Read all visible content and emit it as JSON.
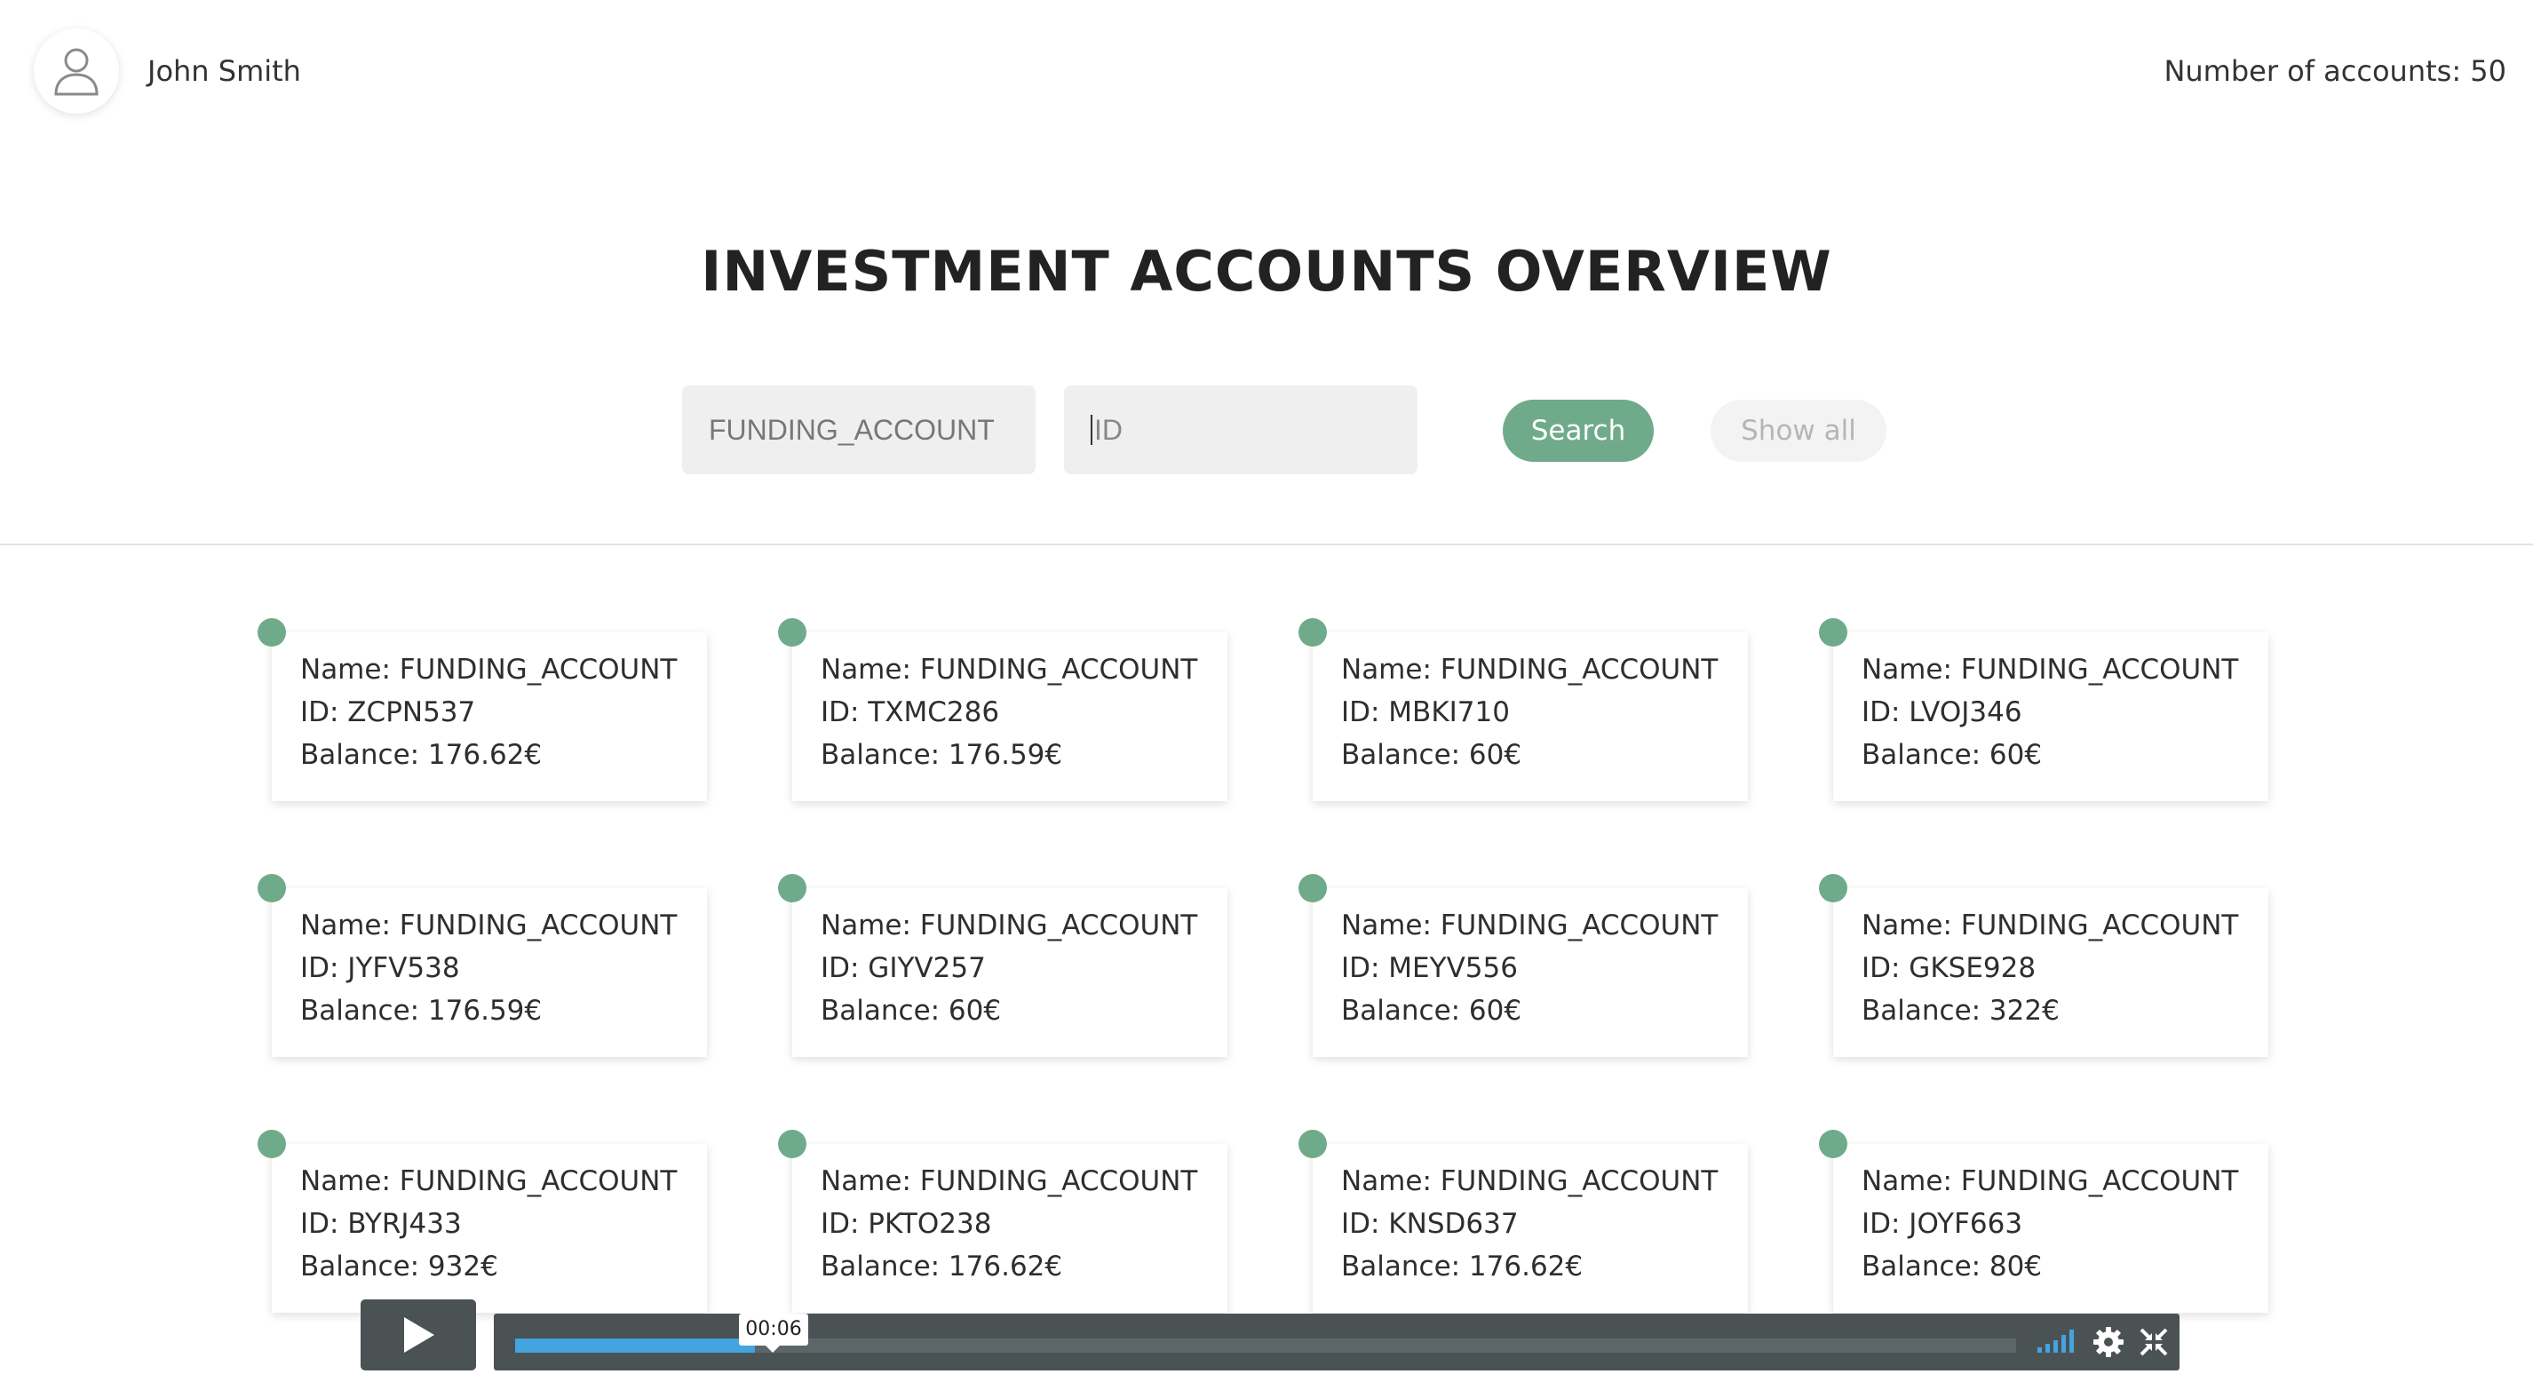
{
  "header": {
    "user_name": "John Smith",
    "account_count": "Number of accounts: 50",
    "avatar_icon": "user-icon"
  },
  "title": "INVESTMENT ACCOUNTS OVERVIEW",
  "search": {
    "name_value": "FUNDING_ACCOUNT",
    "id_placeholder": "ID",
    "search_label": "Search",
    "show_all_label": "Show all"
  },
  "accounts": [
    {
      "name": "Name: FUNDING_ACCOUNT",
      "id": "ID: ZCPN537",
      "balance": "Balance: 176.62€"
    },
    {
      "name": "Name: FUNDING_ACCOUNT",
      "id": "ID: TXMC286",
      "balance": "Balance: 176.59€"
    },
    {
      "name": "Name: FUNDING_ACCOUNT",
      "id": "ID: MBKI710",
      "balance": "Balance: 60€"
    },
    {
      "name": "Name: FUNDING_ACCOUNT",
      "id": "ID: LVOJ346",
      "balance": "Balance: 60€"
    },
    {
      "name": "Name: FUNDING_ACCOUNT",
      "id": "ID: JYFV538",
      "balance": "Balance: 176.59€"
    },
    {
      "name": "Name: FUNDING_ACCOUNT",
      "id": "ID: GIYV257",
      "balance": "Balance: 60€"
    },
    {
      "name": "Name: FUNDING_ACCOUNT",
      "id": "ID: MEYV556",
      "balance": "Balance: 60€"
    },
    {
      "name": "Name: FUNDING_ACCOUNT",
      "id": "ID: GKSE928",
      "balance": "Balance: 322€"
    },
    {
      "name": "Name: FUNDING_ACCOUNT",
      "id": "ID: BYRJ433",
      "balance": "Balance: 932€"
    },
    {
      "name": "Name: FUNDING_ACCOUNT",
      "id": "ID: PKTO238",
      "balance": "Balance: 176.62€"
    },
    {
      "name": "Name: FUNDING_ACCOUNT",
      "id": "ID: KNSD637",
      "balance": "Balance: 176.62€"
    },
    {
      "name": "Name: FUNDING_ACCOUNT",
      "id": "ID: JOYF663",
      "balance": "Balance: 80€"
    }
  ],
  "colors": {
    "accent": "#6fab8a",
    "progress": "#43a4e0",
    "player": "#4a5254"
  },
  "player": {
    "time": "00:06",
    "progress": 0.16,
    "icons": [
      "play-icon",
      "volume-icon",
      "gear-icon",
      "fullscreen-icon"
    ]
  }
}
